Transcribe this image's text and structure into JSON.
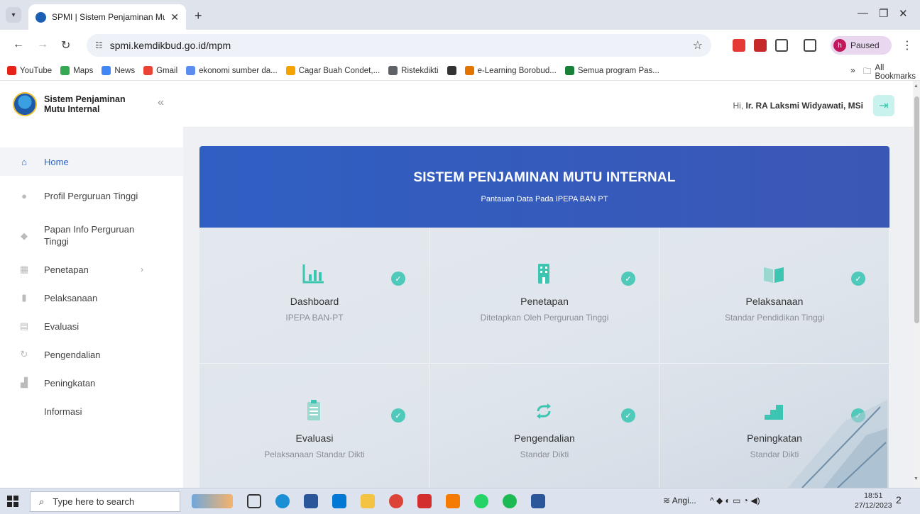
{
  "browser": {
    "tab_title": "SPMI | Sistem Penjaminan Mutu",
    "url": "spmi.kemdikbud.go.id/mpm",
    "profile_label": "Paused",
    "profile_initial": "h",
    "bookmarks": [
      {
        "label": "YouTube",
        "color": "#e62117"
      },
      {
        "label": "Maps",
        "color": "#34a853"
      },
      {
        "label": "News",
        "color": "#4285f4"
      },
      {
        "label": "Gmail",
        "color": "#ea4335"
      },
      {
        "label": "ekonomi sumber da...",
        "color": "#5b8def"
      },
      {
        "label": "Cagar Buah Condet,...",
        "color": "#f4a300"
      },
      {
        "label": "Ristekdikti",
        "color": "#5f6368"
      },
      {
        "label": "",
        "color": "#333333"
      },
      {
        "label": "e-Learning Borobud...",
        "color": "#e37400"
      },
      {
        "label": "Semua program Pas...",
        "color": "#188038"
      }
    ],
    "bookmarks_more": "»",
    "all_bookmarks": "All Bookmarks"
  },
  "sidebar": {
    "brand_line1": "Sistem Penjaminan",
    "brand_line2": "Mutu Internal",
    "items": [
      {
        "label": "Home",
        "icon": "home-icon",
        "active": true
      },
      {
        "label": "Profil Perguruan Tinggi",
        "icon": "user-icon"
      },
      {
        "label": "Papan Info Perguruan Tinggi",
        "icon": "diamond-icon"
      },
      {
        "label": "Penetapan",
        "icon": "building-icon",
        "has_children": true
      },
      {
        "label": "Pelaksanaan",
        "icon": "book-icon"
      },
      {
        "label": "Evaluasi",
        "icon": "clipboard-icon"
      },
      {
        "label": "Pengendalian",
        "icon": "cycle-icon"
      },
      {
        "label": "Peningkatan",
        "icon": "stairs-icon"
      },
      {
        "label": "Informasi",
        "icon": ""
      }
    ]
  },
  "topbar": {
    "greeting": "Hi, ",
    "user_name": "Ir. RA Laksmi Widyawati, MSi"
  },
  "main": {
    "title": "SISTEM PENJAMINAN MUTU INTERNAL",
    "subtitle": "Pantauan Data Pada IPEPA BAN PT",
    "cards": [
      {
        "title": "Dashboard",
        "subtitle": "IPEPA BAN-PT",
        "icon": "bar-chart-icon"
      },
      {
        "title": "Penetapan",
        "subtitle": "Ditetapkan Oleh Perguruan Tinggi",
        "icon": "building-icon"
      },
      {
        "title": "Pelaksanaan",
        "subtitle": "Standar Pendidikan Tinggi",
        "icon": "book-icon"
      },
      {
        "title": "Evaluasi",
        "subtitle": "Pelaksanaan Standar Dikti",
        "icon": "clipboard-icon"
      },
      {
        "title": "Pengendalian",
        "subtitle": "Standar Dikti",
        "icon": "cycle-icon"
      },
      {
        "title": "Peningkatan",
        "subtitle": "Standar Dikti",
        "icon": "stairs-icon"
      }
    ]
  },
  "taskbar": {
    "search_placeholder": "Type here to search",
    "weather": "Angi...",
    "time": "18:51",
    "date": "27/12/2023",
    "notifications": "2"
  },
  "colors": {
    "accent": "#2d66c8",
    "header_blue": "#3b5bbd",
    "teal": "#3cc6b1"
  }
}
